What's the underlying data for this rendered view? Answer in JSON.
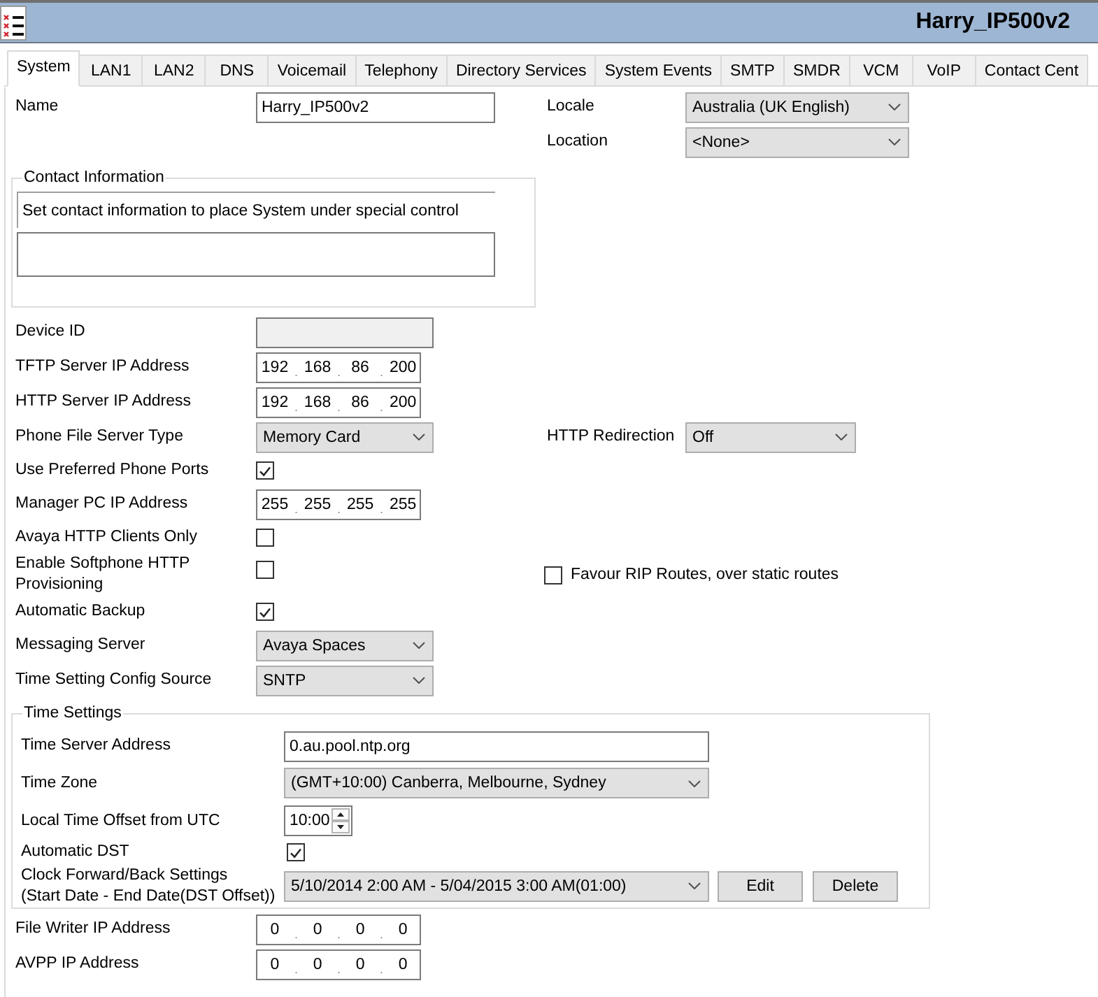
{
  "window": {
    "title": "Harry_IP500v2"
  },
  "tabs": [
    {
      "label": "System",
      "selected": true
    },
    {
      "label": "LAN1",
      "selected": false
    },
    {
      "label": "LAN2",
      "selected": false
    },
    {
      "label": "DNS",
      "selected": false
    },
    {
      "label": "Voicemail",
      "selected": false
    },
    {
      "label": "Telephony",
      "selected": false
    },
    {
      "label": "Directory Services",
      "selected": false
    },
    {
      "label": "System Events",
      "selected": false
    },
    {
      "label": "SMTP",
      "selected": false
    },
    {
      "label": "SMDR",
      "selected": false
    },
    {
      "label": "VCM",
      "selected": false
    },
    {
      "label": "VoIP",
      "selected": false
    },
    {
      "label": "Contact Cent",
      "selected": false
    }
  ],
  "rows": [
    {
      "left": {
        "kind": "text",
        "label": "Name",
        "value": "Harry_IP500v2",
        "disabled": false
      },
      "right": {
        "kind": "dropdown",
        "label": "Locale",
        "value": "Australia (UK English)"
      }
    },
    {
      "right": {
        "kind": "dropdown",
        "label": "Location",
        "value": "<None>"
      }
    },
    {
      "left": {
        "kind": "note_group",
        "title": "Contact Information",
        "note": "Set contact information to place System under special control"
      }
    },
    {
      "left": {
        "kind": "text",
        "label": "Device ID",
        "disabled": true
      }
    },
    {
      "left": {
        "kind": "ip",
        "label": "TFTP Server IP Address",
        "value": "192 . 168 . 86 . 200"
      }
    },
    {
      "left": {
        "kind": "ip",
        "label": "HTTP Server IP Address",
        "value": "192 . 168 . 86 . 200"
      }
    },
    {
      "left": {
        "kind": "dropdown",
        "label": "Phone File Server Type",
        "value": "Memory Card"
      },
      "right": {
        "kind": "dropdown",
        "label": "HTTP Redirection",
        "value": "Off"
      }
    },
    {
      "left": {
        "kind": "checkbox",
        "label": "Use Preferred Phone Ports",
        "checked": true
      }
    },
    {
      "left": {
        "kind": "ip",
        "label": "Manager PC IP Address",
        "value": "255 . 255 . 255 . 255"
      }
    },
    {
      "left": {
        "kind": "checkbox",
        "label": "Avaya HTTP Clients Only",
        "checked": false
      }
    },
    {
      "left": {
        "kind": "checkbox",
        "label": "Enable Softphone HTTP Provisioning",
        "checked": false
      },
      "right": {
        "kind": "inline_checkbox",
        "label": "Favour RIP Routes, over static routes",
        "checked": false
      }
    },
    {
      "left": {
        "kind": "checkbox",
        "label": "Automatic Backup",
        "checked": true
      }
    },
    {
      "left": {
        "kind": "dropdown",
        "label": "Messaging Server",
        "value": "Avaya Spaces"
      }
    },
    {
      "left": {
        "kind": "dropdown",
        "label": "Time Setting Config Source",
        "value": "SNTP"
      }
    },
    {
      "left": {
        "kind": "field_group",
        "title": "Time Settings",
        "rows": [
          {
            "kind": "text",
            "label": "Time Server Address",
            "value": "0.au.pool.ntp.org",
            "disabled": false
          },
          {
            "kind": "dropdown",
            "label": "Time Zone",
            "value": "(GMT+10:00) Canberra, Melbourne, Sydney"
          },
          {
            "kind": "spin",
            "label": "Local Time Offset from UTC",
            "value": "10:00"
          },
          {
            "kind": "checkbox",
            "label": "Automatic DST",
            "checked": true
          },
          {
            "kind": "dropdown_buttons",
            "label": "Clock Forward/Back Settings\n(Start Date - End Date(DST Offset))",
            "value": "5/10/2014 2:00 AM - 5/04/2015 3:00 AM(01:00)",
            "buttons": [
              "Edit",
              "Delete"
            ]
          }
        ]
      }
    },
    {
      "left": {
        "kind": "ip",
        "label": "File Writer IP Address",
        "value": "0 . 0 . 0 . 0"
      }
    },
    {
      "left": {
        "kind": "ip",
        "label": "AVPP IP Address",
        "value": "0 . 0 . 0 . 0"
      }
    }
  ]
}
